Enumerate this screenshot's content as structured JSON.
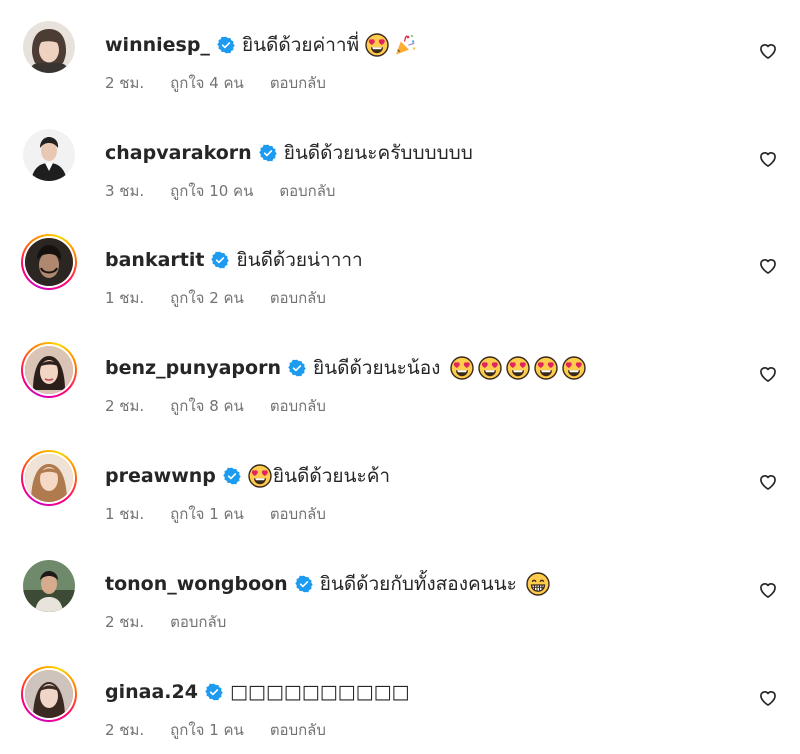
{
  "colors": {
    "verified_badge": "#1d9bf0",
    "meta_text": "#737373",
    "primary_text": "#262626"
  },
  "comments": [
    {
      "username": "winniesp_",
      "text": "ยินดีด้วยค่าาพี่",
      "emojis_after": [
        "heart-eyes-emoji",
        "party-popper-emoji"
      ],
      "time": "2 ชม.",
      "likes": "ถูกใจ 4 คน",
      "reply": "ตอบกลับ",
      "story_ring": false
    },
    {
      "username": "chapvarakorn",
      "text": "ยินดีด้วยนะครับบบบบบ",
      "emojis_after": [],
      "time": "3 ชม.",
      "likes": "ถูกใจ 10 คน",
      "reply": "ตอบกลับ",
      "story_ring": false
    },
    {
      "username": "bankartit",
      "text": "ยินดีด้วยน่าาาา",
      "emojis_after": [],
      "time": "1 ชม.",
      "likes": "ถูกใจ 2 คน",
      "reply": "ตอบกลับ",
      "story_ring": true
    },
    {
      "username": "benz_punyaporn",
      "text": "ยินดีด้วยนะน้อง",
      "emojis_after": [
        "heart-eyes-emoji",
        "heart-eyes-emoji",
        "heart-eyes-emoji",
        "heart-eyes-emoji",
        "heart-eyes-emoji"
      ],
      "time": "2 ชม.",
      "likes": "ถูกใจ 8 คน",
      "reply": "ตอบกลับ",
      "story_ring": true
    },
    {
      "username": "preawwnp",
      "text": "ยินดีด้วยนะค้า",
      "emojis_before": [
        "heart-eyes-emoji"
      ],
      "time": "1 ชม.",
      "likes": "ถูกใจ 1 คน",
      "reply": "ตอบกลับ",
      "story_ring": true
    },
    {
      "username": "tonon_wongboon",
      "text": "ยินดีด้วยกับทั้งสองคนนะ",
      "emojis_after": [
        "grinning-emoji"
      ],
      "time": "2 ชม.",
      "likes": "",
      "reply": "ตอบกลับ",
      "story_ring": false
    },
    {
      "username": "ginaa.24",
      "text": "□□□□□□□□□□",
      "emojis_after": [],
      "time": "2 ชม.",
      "likes": "ถูกใจ 1 คน",
      "reply": "ตอบกลับ",
      "story_ring": true
    }
  ]
}
